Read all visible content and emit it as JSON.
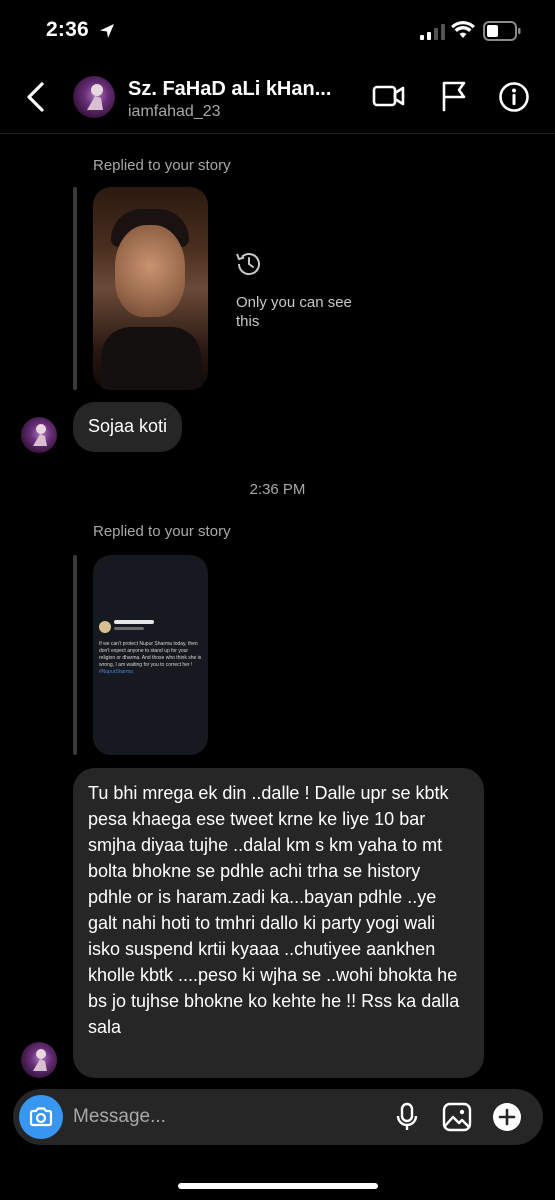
{
  "status_bar": {
    "time": "2:36"
  },
  "header": {
    "title": "Sz. FaHaD aLi kHan...",
    "username": "iamfahad_23"
  },
  "thread": {
    "reply1": {
      "label": "Replied to your story",
      "expired_text": "Only you can see this",
      "message": "Sojaa koti"
    },
    "timestamp": "2:36 PM",
    "reply2": {
      "label": "Replied to your story",
      "story_text": "If we can't protect Nupur Sharma today, then don't expect anyone to stand up for your religion or dharma. And those who think she is wrong, I am waiting for you to correct her !",
      "story_tag": "#NupurSharma",
      "message": "Tu bhi mrega ek din ..dalle ! Dalle upr se kbtk pesa khaega ese tweet krne ke liye 10 bar smjha diyaa tujhe ..dalal km s km yaha to mt bolta bhokne se pdhle achi trha se history pdhle or is haram.zadi ka...bayan pdhle ..ye galt nahi hoti to tmhri dallo ki party yogi wali isko suspend krtii kyaaa ..chutiyee aankhen kholle kbtk ....peso ki wjha se ..wohi bhokta he bs jo tujhse bhokne ko kehte he !! Rss ka dalla sala"
    }
  },
  "composer": {
    "placeholder": "Message..."
  },
  "colors": {
    "background": "#000000",
    "bubble": "#262626",
    "camera": "#3797f0"
  }
}
